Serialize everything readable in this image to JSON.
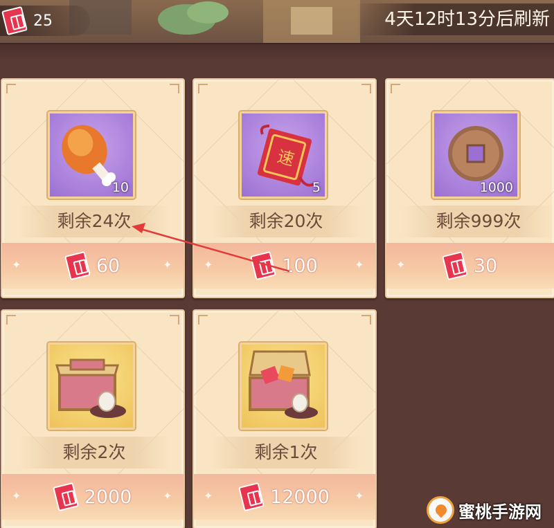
{
  "header": {
    "currency_icon": "wine-ticket-icon",
    "currency_value": "25",
    "refresh_text": "4天12时13分后刷新"
  },
  "shop_items": [
    {
      "name": "roast-drumstick",
      "icon": "drumstick-icon",
      "qty": "10",
      "remaining": "剩余24次",
      "price": "60",
      "frame": "purple"
    },
    {
      "name": "speed-talisman",
      "icon": "speed-talisman-icon",
      "qty": "5",
      "remaining": "剩余20次",
      "price": "100",
      "frame": "purple"
    },
    {
      "name": "copper-coin",
      "icon": "copper-coin-icon",
      "qty": "1000",
      "remaining": "剩余999次",
      "price": "30",
      "frame": "purple"
    },
    {
      "name": "open-gift-box",
      "icon": "gift-box-icon",
      "qty": "",
      "remaining": "剩余2次",
      "price": "2000",
      "frame": "gold"
    },
    {
      "name": "treasure-chest",
      "icon": "treasure-chest-icon",
      "qty": "",
      "remaining": "剩余1次",
      "price": "12000",
      "frame": "gold"
    }
  ],
  "colors": {
    "background": "#5a3a34",
    "card": "#f9e5c4",
    "ticket": "#e8354f",
    "annotation_arrow": "#e23b3b"
  },
  "watermark": {
    "icon": "peach-logo-icon",
    "text": "蜜桃手游网"
  }
}
